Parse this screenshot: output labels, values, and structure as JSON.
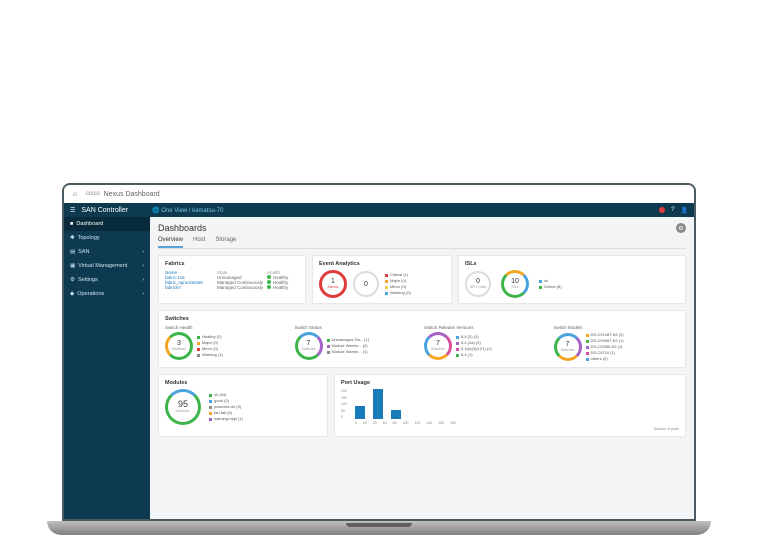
{
  "topbar": {
    "logo_top": "cisco",
    "title": "Nexus Dashboard"
  },
  "subbar": {
    "product": "SAN Controller",
    "crumb1": "One View",
    "crumb2": "kamatsu-70"
  },
  "sidebar": {
    "items": [
      {
        "label": "Dashboard"
      },
      {
        "label": "Topology"
      },
      {
        "label": "SAN"
      },
      {
        "label": "Virtual Management"
      },
      {
        "label": "Settings"
      },
      {
        "label": "Operations"
      }
    ]
  },
  "page": {
    "title": "Dashboards",
    "tabs": [
      "Overview",
      "Host",
      "Storage"
    ]
  },
  "fabrics": {
    "title": "Fabrics",
    "headers": [
      "Name",
      "State",
      "Health"
    ],
    "rows": [
      {
        "name": "fabric-116",
        "state": "Unmanaged",
        "health": "Healthy"
      },
      {
        "name": "fabric_sprockets05",
        "state": "Managed Continuously",
        "health": "Healthy"
      },
      {
        "name": "fabric67",
        "state": "Managed Continuously",
        "health": "Healthy"
      }
    ]
  },
  "event": {
    "title": "Event Analytics",
    "ring1": {
      "value": "1",
      "label": "Alarms",
      "color": "#e03c3c"
    },
    "ring2": {
      "value": "0",
      "label": ""
    },
    "legend": [
      {
        "c": "#e03c3c",
        "t": "Critical (1)"
      },
      {
        "c": "#f6a623",
        "t": "Major (0)"
      },
      {
        "c": "#f0d33a",
        "t": "Minor (0)"
      },
      {
        "c": "#4aa3df",
        "t": "Warning (0)"
      }
    ]
  },
  "isls": {
    "title": "ISLs",
    "ring1": {
      "value": "0",
      "label": "NPV Links"
    },
    "ring2": {
      "value": "10",
      "label": "ISLs",
      "colors": [
        "#3bb54a",
        "#f6a623",
        "#4aa3df"
      ]
    },
    "legend": [
      {
        "c": "#4aa3df",
        "t": "ok"
      },
      {
        "c": "#3bb54a",
        "t": "Online (8)"
      }
    ]
  },
  "switches": {
    "title": "Switches",
    "health": {
      "title": "Switch Health",
      "value": "3",
      "label": "Switches",
      "colors": [
        "#3bb54a",
        "#f6a623"
      ],
      "legend": [
        {
          "c": "#3bb54a",
          "t": "Healthy (2)"
        },
        {
          "c": "#f6a623",
          "t": "Major (0)"
        },
        {
          "c": "#e03c3c",
          "t": "Minor (0)"
        },
        {
          "c": "#888",
          "t": "Warning (1)"
        }
      ]
    },
    "sync": {
      "title": "Switch Status",
      "value": "7",
      "label": "Switches",
      "colors": [
        "#3bb54a",
        "#4aa3df",
        "#a463c7"
      ],
      "legend": [
        {
          "c": "#3bb54a",
          "t": "Unmanaged Sw... (1)"
        },
        {
          "c": "#a463c7",
          "t": "Module Warnin... (2)"
        },
        {
          "c": "#888",
          "t": "Module Warnin... (1)"
        }
      ]
    },
    "release": {
      "title": "Switch Release Versions",
      "value": "7",
      "label": "Switches",
      "colors": [
        "#4aa3df",
        "#a463c7",
        "#d94f9e",
        "#f6a623"
      ],
      "legend": [
        {
          "c": "#4aa3df",
          "t": "8.4 (2) (2)"
        },
        {
          "c": "#a463c7",
          "t": "8.4 (2a) (2)"
        },
        {
          "c": "#d94f9e",
          "t": "8.4(b)(0)(121) (1)"
        },
        {
          "c": "#3bb54a",
          "t": "8.4 (1)"
        }
      ]
    },
    "model": {
      "title": "Switch Models",
      "value": "7",
      "label": "Switches",
      "colors": [
        "#3bb54a",
        "#4aa3df",
        "#a463c7",
        "#f6a623",
        "#d94f9e"
      ],
      "legend": [
        {
          "c": "#f6a623",
          "t": "DS-C9148T-K9 (2)"
        },
        {
          "c": "#3bb54a",
          "t": "DS-C9396T-K9 (1)"
        },
        {
          "c": "#a463c7",
          "t": "DS-C9250I-K9 (1)"
        },
        {
          "c": "#d94f9e",
          "t": "DS-C9710 (1)"
        },
        {
          "c": "#4aa3df",
          "t": "others (2)"
        }
      ]
    }
  },
  "modules": {
    "title": "Modules",
    "value": "95",
    "label": "Modules",
    "colors": [
      "#3bb54a",
      "#4aa3df"
    ],
    "legend": [
      {
        "c": "#3bb54a",
        "t": "ok (94)"
      },
      {
        "c": "#4aa3df",
        "t": "good (2)"
      },
      {
        "c": "#888",
        "t": "powered-dn (0)"
      },
      {
        "c": "#f6a623",
        "t": "fan-fail (0)"
      },
      {
        "c": "#a463c7",
        "t": "warning-high (1)"
      }
    ]
  },
  "port": {
    "title": "Port Usage",
    "ylabels": [
      "200",
      "150",
      "100",
      "50",
      "0"
    ],
    "xlabels": [
      "0",
      "20",
      "40",
      "60",
      "80",
      "100",
      "120",
      "140",
      "160",
      "180"
    ],
    "xlabel2": "Number of ports",
    "bars": [
      45,
      100,
      30
    ]
  }
}
